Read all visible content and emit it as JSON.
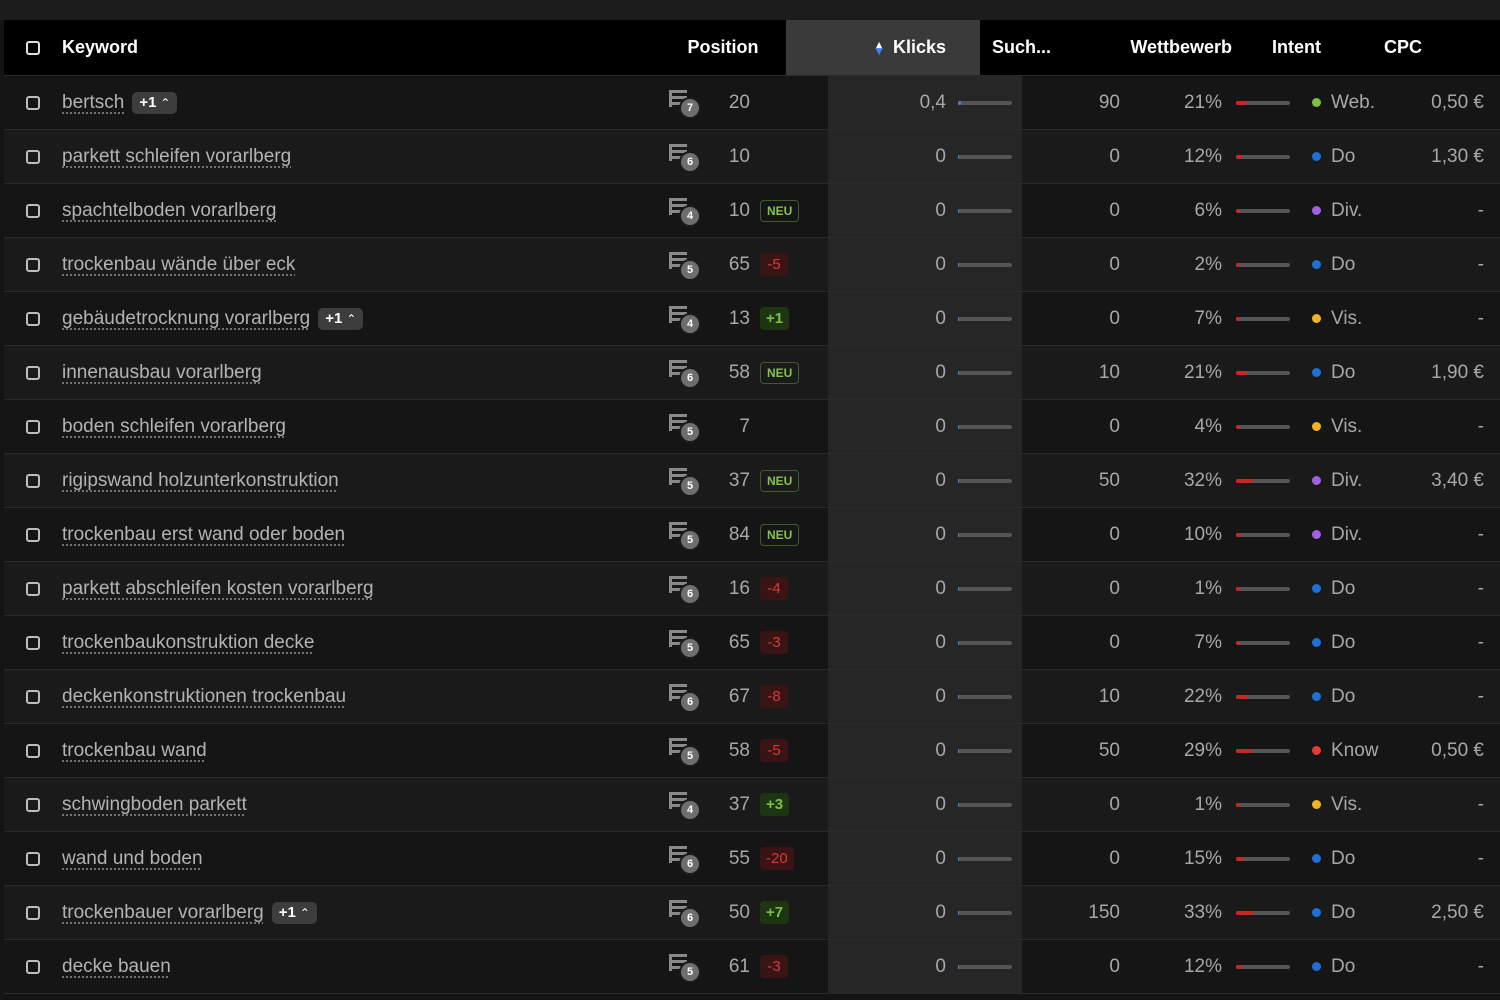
{
  "header": {
    "keyword": "Keyword",
    "position": "Position",
    "clicks": "Klicks",
    "search_volume": "Such...",
    "competition": "Wettbewerb",
    "intent": "Intent",
    "cpc": "CPC"
  },
  "colors": {
    "intent_web": "#7cc242",
    "intent_do": "#1e6fd9",
    "intent_div": "#a35ee6",
    "intent_vis": "#f2b521",
    "intent_know": "#e53935",
    "sort_up": "#ffffff",
    "sort_down": "#3b82f6"
  },
  "rows": [
    {
      "keyword": "bertsch",
      "more": "+1",
      "serp": "7",
      "position": "20",
      "change": "",
      "change_type": "none",
      "clicks": "0,4",
      "clicks_fill": 0.05,
      "search": "90",
      "competition": "21%",
      "comp_fill": 0.21,
      "intent": "Web.",
      "intent_color": "#7cc242",
      "cpc": "0,50 €"
    },
    {
      "keyword": "parkett schleifen vorarlberg",
      "more": "",
      "serp": "6",
      "position": "10",
      "change": "",
      "change_type": "none",
      "clicks": "0",
      "clicks_fill": 0.02,
      "search": "0",
      "competition": "12%",
      "comp_fill": 0.12,
      "intent": "Do",
      "intent_color": "#1e6fd9",
      "cpc": "1,30 €"
    },
    {
      "keyword": "spachtelboden vorarlberg",
      "more": "",
      "serp": "4",
      "position": "10",
      "change": "NEU",
      "change_type": "neu",
      "clicks": "0",
      "clicks_fill": 0.02,
      "search": "0",
      "competition": "6%",
      "comp_fill": 0.06,
      "intent": "Div.",
      "intent_color": "#a35ee6",
      "cpc": "-"
    },
    {
      "keyword": "trockenbau wände über eck",
      "more": "",
      "serp": "5",
      "position": "65",
      "change": "-5",
      "change_type": "down",
      "clicks": "0",
      "clicks_fill": 0.02,
      "search": "0",
      "competition": "2%",
      "comp_fill": 0.02,
      "intent": "Do",
      "intent_color": "#1e6fd9",
      "cpc": "-"
    },
    {
      "keyword": "gebäudetrocknung vorarlberg",
      "more": "+1",
      "serp": "4",
      "position": "13",
      "change": "+1",
      "change_type": "up",
      "clicks": "0",
      "clicks_fill": 0.02,
      "search": "0",
      "competition": "7%",
      "comp_fill": 0.07,
      "intent": "Vis.",
      "intent_color": "#f2b521",
      "cpc": "-"
    },
    {
      "keyword": "innenausbau vorarlberg",
      "more": "",
      "serp": "6",
      "position": "58",
      "change": "NEU",
      "change_type": "neu",
      "clicks": "0",
      "clicks_fill": 0.02,
      "search": "10",
      "competition": "21%",
      "comp_fill": 0.21,
      "intent": "Do",
      "intent_color": "#1e6fd9",
      "cpc": "1,90 €"
    },
    {
      "keyword": "boden schleifen vorarlberg",
      "more": "",
      "serp": "5",
      "position": "7",
      "change": "",
      "change_type": "none",
      "clicks": "0",
      "clicks_fill": 0.02,
      "search": "0",
      "competition": "4%",
      "comp_fill": 0.04,
      "intent": "Vis.",
      "intent_color": "#f2b521",
      "cpc": "-"
    },
    {
      "keyword": "rigipswand holzunterkonstruktion",
      "more": "",
      "serp": "5",
      "position": "37",
      "change": "NEU",
      "change_type": "neu",
      "clicks": "0",
      "clicks_fill": 0.02,
      "search": "50",
      "competition": "32%",
      "comp_fill": 0.32,
      "intent": "Div.",
      "intent_color": "#a35ee6",
      "cpc": "3,40 €"
    },
    {
      "keyword": "trockenbau erst wand oder boden",
      "more": "",
      "serp": "5",
      "position": "84",
      "change": "NEU",
      "change_type": "neu",
      "clicks": "0",
      "clicks_fill": 0.02,
      "search": "0",
      "competition": "10%",
      "comp_fill": 0.1,
      "intent": "Div.",
      "intent_color": "#a35ee6",
      "cpc": "-"
    },
    {
      "keyword": "parkett abschleifen kosten vorarlberg",
      "more": "",
      "serp": "6",
      "position": "16",
      "change": "-4",
      "change_type": "down",
      "clicks": "0",
      "clicks_fill": 0.02,
      "search": "0",
      "competition": "1%",
      "comp_fill": 0.01,
      "intent": "Do",
      "intent_color": "#1e6fd9",
      "cpc": "-"
    },
    {
      "keyword": "trockenbaukonstruktion decke",
      "more": "",
      "serp": "5",
      "position": "65",
      "change": "-3",
      "change_type": "down",
      "clicks": "0",
      "clicks_fill": 0.02,
      "search": "0",
      "competition": "7%",
      "comp_fill": 0.07,
      "intent": "Do",
      "intent_color": "#1e6fd9",
      "cpc": "-"
    },
    {
      "keyword": "deckenkonstruktionen trockenbau",
      "more": "",
      "serp": "6",
      "position": "67",
      "change": "-8",
      "change_type": "down",
      "clicks": "0",
      "clicks_fill": 0.02,
      "search": "10",
      "competition": "22%",
      "comp_fill": 0.22,
      "intent": "Do",
      "intent_color": "#1e6fd9",
      "cpc": "-"
    },
    {
      "keyword": "trockenbau wand",
      "more": "",
      "serp": "5",
      "position": "58",
      "change": "-5",
      "change_type": "down",
      "clicks": "0",
      "clicks_fill": 0.02,
      "search": "50",
      "competition": "29%",
      "comp_fill": 0.29,
      "intent": "Know",
      "intent_color": "#e53935",
      "cpc": "0,50 €"
    },
    {
      "keyword": "schwingboden parkett",
      "more": "",
      "serp": "4",
      "position": "37",
      "change": "+3",
      "change_type": "up",
      "clicks": "0",
      "clicks_fill": 0.02,
      "search": "0",
      "competition": "1%",
      "comp_fill": 0.01,
      "intent": "Vis.",
      "intent_color": "#f2b521",
      "cpc": "-"
    },
    {
      "keyword": "wand und boden",
      "more": "",
      "serp": "6",
      "position": "55",
      "change": "-20",
      "change_type": "down",
      "clicks": "0",
      "clicks_fill": 0.02,
      "search": "0",
      "competition": "15%",
      "comp_fill": 0.15,
      "intent": "Do",
      "intent_color": "#1e6fd9",
      "cpc": "-"
    },
    {
      "keyword": "trockenbauer vorarlberg",
      "more": "+1",
      "serp": "6",
      "position": "50",
      "change": "+7",
      "change_type": "up",
      "clicks": "0",
      "clicks_fill": 0.02,
      "search": "150",
      "competition": "33%",
      "comp_fill": 0.33,
      "intent": "Do",
      "intent_color": "#1e6fd9",
      "cpc": "2,50 €"
    },
    {
      "keyword": "decke bauen",
      "more": "",
      "serp": "5",
      "position": "61",
      "change": "-3",
      "change_type": "down",
      "clicks": "0",
      "clicks_fill": 0.02,
      "search": "0",
      "competition": "12%",
      "comp_fill": 0.12,
      "intent": "Do",
      "intent_color": "#1e6fd9",
      "cpc": "-"
    }
  ]
}
